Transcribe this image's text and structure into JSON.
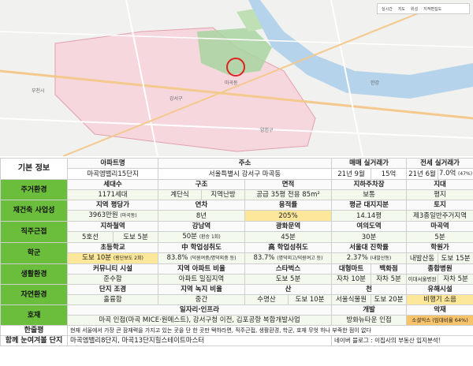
{
  "map": {
    "labels": [
      "부천시",
      "양천구",
      "강서구",
      "마곡동",
      "한강"
    ],
    "controls": [
      "실시간",
      "지도",
      "위성",
      "지적편집도"
    ]
  },
  "header": {
    "section": "기본 정보",
    "apt_name_h": "아파트명",
    "apt_name": "마곡엠밸리15단지",
    "address_h": "주소",
    "address": "서울특별시 강서구 마곡동",
    "sale_h": "매매 실거래가",
    "sale_date": "21년 9월",
    "sale_price": "15억",
    "rent_h": "전세 실거래가",
    "rent_date": "21년 6월",
    "rent_price": "7.0억",
    "rent_ratio": "(47%)"
  },
  "housing": {
    "label": "주거환경",
    "h": [
      "세대수",
      "구조",
      "면적",
      "지하주차장",
      "지대"
    ],
    "households": "1171세대",
    "type": "계단식",
    "heating": "지역난방",
    "area": "공급 35평 전용 85m²",
    "parking": "보통",
    "land": "평지"
  },
  "rebuild": {
    "label": "재건축 사업성",
    "h": [
      "지역 평당가",
      "연차",
      "용적률",
      "평균 대지지분",
      "토지"
    ],
    "price": "3963만원",
    "price_note": "(마곡동)",
    "age": "8년",
    "far": "205%",
    "land_share": "14.14평",
    "zone": "제3종일반주거지역"
  },
  "commute": {
    "label": "직주근접",
    "h": [
      "지하철역",
      "강남역",
      "광화문역",
      "여의도역",
      "마곡역"
    ],
    "line": "5호선",
    "walk": "도보 5분",
    "gangnam": "50분",
    "gangnam_note": "(환승 1회)",
    "gwanghwamun": "45분",
    "yeouido": "30분",
    "magok": "5분"
  },
  "school": {
    "label": "학군",
    "h": [
      "초등학교",
      "中 학업성취도",
      "高 학업성취도",
      "서울대 진학률",
      "학원가"
    ],
    "elem": "도보 10분",
    "elem_note": "(횡단보도 2회)",
    "middle": "83.8%",
    "middle_note": "(덕원여중/명덕외중 등)",
    "high": "83.7%",
    "high_note": "(명덕외고/덕원여고 등)",
    "snu": "2.37%",
    "snu_note": "(내발산동)",
    "academy": "내발산동",
    "academy_time": "도보 15분"
  },
  "living": {
    "label": "생활환경",
    "h": [
      "커뮤니티 시설",
      "지역 아파트 비율",
      "스타벅스",
      "대형마트",
      "백화점",
      "종합병원"
    ],
    "community": "준수함",
    "apt_ratio": "아파트 밀집지역",
    "starbucks": "도보 5분",
    "mart": "자차 10분",
    "dept": "자차 5분",
    "hospital_note": "이대서울병원",
    "hospital": "자차 5분"
  },
  "nature": {
    "label": "자연환경",
    "h": [
      "단지 조경",
      "지역 녹지 비율",
      "산",
      "천",
      "유해시설"
    ],
    "landscape": "훌륭함",
    "green": "중간",
    "mountain": "수명산",
    "mountain_time": "도보 10분",
    "stream": "서울식물원",
    "stream_time": "도보 20분",
    "hazard": "비행기 소음"
  },
  "positive": {
    "label": "호재",
    "h": [
      "일자리·인프라",
      "개발",
      "악재"
    ],
    "jobs": "마곡 인접(마곡 MICE·원메스트), 강서구청 이전, 김포공항 복합개발사업",
    "dev": "방화뉴타운 인접",
    "bad": "소셜믹스 (임대비율 64%)"
  },
  "review": {
    "label": "한줄평",
    "text": "현재 서울에서 가장 큰 잠재력을 가지고 있는 곳을 단 한 곳만 택하라면, 직주근접, 생활환경, 학군, 호재 무엇 하나 부족한 점이 없다"
  },
  "compare": {
    "label": "함께 눈여겨볼 단지",
    "text": "마곡엠밸리8단지, 마곡13단지힐스테이트마스터",
    "blog": "네이버 블로그 : 이집사의 부동산 입지분석!"
  }
}
